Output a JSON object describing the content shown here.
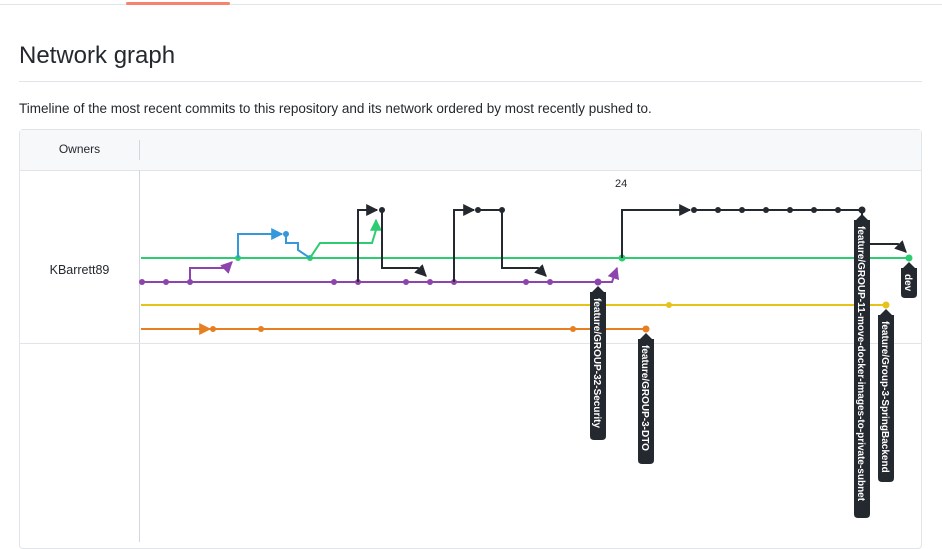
{
  "page": {
    "title": "Network graph",
    "description": "Timeline of the most recent commits to this repository and its network ordered by most recently pushed to."
  },
  "table": {
    "owners_header": "Owners",
    "owner_name": "KBarrett89"
  },
  "graph": {
    "date_label": "24",
    "colors": {
      "green": "#2ecc71",
      "purple": "#8e44ad",
      "yellow": "#e6c21a",
      "orange": "#e67e22",
      "blue": "#3498db",
      "black": "#24292f",
      "flag_bg": "#24292f"
    },
    "branch_labels": [
      "feature/GROUP-32-Security",
      "feature/GROUP-3-DTO",
      "feature/GROUP-11-move-docker-images-to-private-subnet",
      "feature/Group-3-SpringBackend",
      "dev"
    ]
  }
}
